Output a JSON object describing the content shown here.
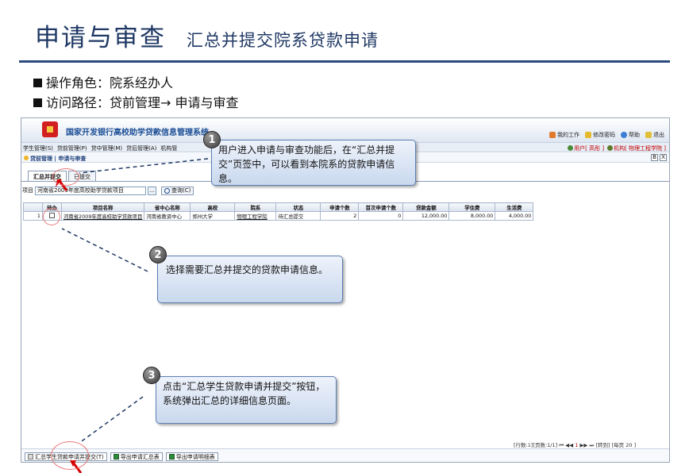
{
  "slide": {
    "title": "申请与审查",
    "subtitle": "汇总并提交院系贷款申请",
    "bullets": [
      "操作角色：院系经办人",
      "访问路径：贷前管理→ 申请与审查"
    ]
  },
  "app": {
    "name": "国家开发银行高校助学贷款信息管理系统",
    "top_links": [
      "我的工作",
      "修改密码",
      "帮助",
      "退出"
    ],
    "menu": [
      "学生管理(S)",
      "贷前管理(P)",
      "贷中管理(M)",
      "贷后管理(A)",
      "机构管"
    ],
    "user_label": "用户[ 高彤 ]",
    "org_label": "机构[ 物理工程学院 ]",
    "breadcrumb": "贷前管理 | 申请与审查",
    "window_buttons": [
      "B",
      "X"
    ],
    "tabs": [
      "汇总并提交",
      "已提交"
    ],
    "filter": {
      "label": "项目",
      "value": "河南省2009年度高校助学贷款项目",
      "ellipsis": "...",
      "query_button": "查询(C)"
    },
    "table": {
      "columns": [
        "",
        "待办",
        "项目名称",
        "省中心名称",
        "高校",
        "院系",
        "状态",
        "申请个数",
        "首次申请个数",
        "贷款金额",
        "学住费",
        "生活费"
      ],
      "rows": [
        [
          "1",
          "",
          "河南省2009年度高校助学贷款项目",
          "河南省教资中心",
          "郑州大学",
          "物理工程学院",
          "待汇总提交",
          "2",
          "0",
          "12,000.00",
          "8,000.00",
          "4,000.00"
        ]
      ]
    },
    "bottom_buttons": [
      "汇总学生贷款申请并提交(T)",
      "导出申请汇总表",
      "导出申请明细表"
    ],
    "pager": {
      "rows": "[行数:1]",
      "pages": "[页数:1/1]",
      "nav_left": "⏮ ◀◀",
      "current": "1",
      "nav_right": "▶▶ ⏭",
      "goto": "[转到]",
      "page_size_label": "[每页",
      "page_size": "20",
      "page_size_end": "]"
    }
  },
  "callouts": [
    {
      "number": "1",
      "text": "用户进入申请与审查功能后，在“汇总并提交”页签中，可以看到本院系的贷款申请信息。"
    },
    {
      "number": "2",
      "text": "选择需要汇总并提交的贷款申请信息。"
    },
    {
      "number": "3",
      "text": "点击“汇总学生贷款申请并提交”按钮，系统弹出汇总的详细信息页面。"
    }
  ]
}
